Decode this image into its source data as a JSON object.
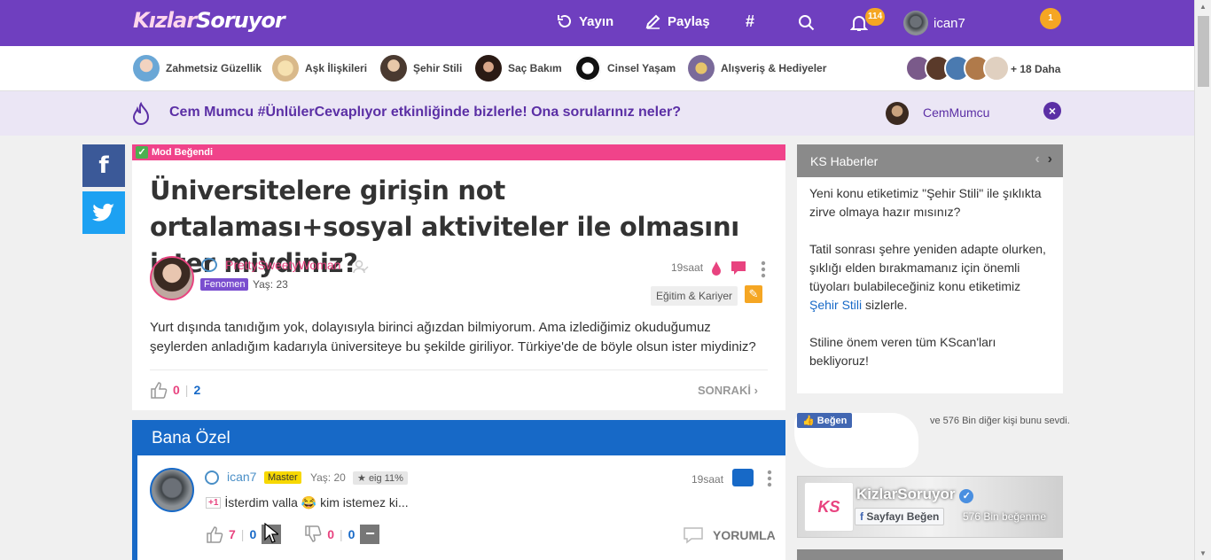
{
  "header": {
    "logo_main": "Kızlar",
    "logo_accent": "Soruyor",
    "nav": {
      "yayin": "Yayın",
      "paylas": "Paylaş",
      "hash": "#"
    },
    "notification_count": "114",
    "username": "ican7",
    "extra_badge": "1",
    "color": "#6f3fbf"
  },
  "categories": {
    "items": [
      {
        "label": "Zahmetsiz Güzellik"
      },
      {
        "label": "Aşk İlişkileri"
      },
      {
        "label": "Şehir Stili"
      },
      {
        "label": "Saç Bakım"
      },
      {
        "label": "Cinsel Yaşam"
      },
      {
        "label": "Alışveriş & Hediyeler"
      }
    ],
    "more": "+ 18 Daha"
  },
  "banner": {
    "text": "Cem Mumcu #ÜnlülerCevaplıyor etkinliğinde bizlerle! Ona sorularınız neler?",
    "user": "CemMumcu",
    "close": "×"
  },
  "share": {
    "facebook": "f",
    "twitter": "t"
  },
  "question": {
    "mod_label": "Mod Beğendi",
    "title": "Üniversitelere girişin not ortalaması+sosyal aktiviteler ile olmasını ister miydiniz?",
    "author": "PrettySweetyWoman",
    "badge": "Fenomen",
    "age": "Yaş: 23",
    "time": "19saat",
    "category": "Eğitim & Kariyer",
    "body": "Yurt dışında tanıdığım yok, dolayısıyla birinci ağızdan bilmiyorum. Ama izlediğimiz okuduğumuz şeylerden anladığım kadarıyla üniversiteye bu şekilde giriliyor. Türkiye'de de böyle olsun ister miydiniz?",
    "likes": "0",
    "answers": "2",
    "next": "SONRAKİ"
  },
  "recommended": {
    "title": "Bana Özel",
    "author": "ican7",
    "rank": "Master",
    "age": "Yaş: 20",
    "eig": "eig 11%",
    "time": "19saat",
    "plus": "+1",
    "text": "İsterdim valla 😂 kim istemez ki...",
    "likes": "7",
    "like_extra": "0",
    "dislikes": "0",
    "dislike_extra": "0",
    "comment": "YORUMLA"
  },
  "news": {
    "title": "KS Haberler",
    "p1": "Yeni konu etiketimiz \"Şehir Stili\" ile şıklıkta zirve olmaya hazır mısınız?",
    "p2_a": "Tatil sonrası şehre yeniden adapte olurken, şıklığı elden bırakmamanız için önemli tüyoları bulabileceğiniz konu etiketimiz ",
    "p2_link": "Şehir Stili",
    "p2_b": " sizlerle.",
    "p3": "Stiline önem veren tüm KScan'ları bekliyoruz!"
  },
  "facebook": {
    "like_btn": "Beğen",
    "like_text": "ve 576 Bin diğer kişi bunu sevdi.",
    "page_name": "KizlarSoruyor",
    "page_btn": "Sayfayı Beğen",
    "page_count": "576 Bin beğenme",
    "logo": "KS"
  }
}
